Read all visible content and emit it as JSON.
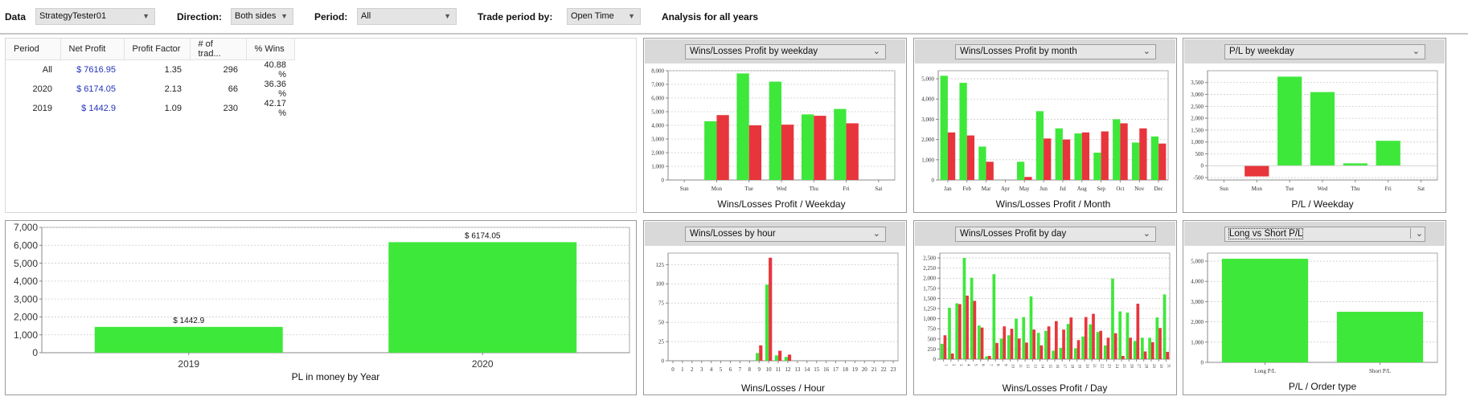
{
  "toolbar": {
    "data_label": "Data",
    "data_value": "StrategyTester01",
    "direction_label": "Direction:",
    "direction_value": "Both sides",
    "period_label": "Period:",
    "period_value": "All",
    "trade_period_label": "Trade period by:",
    "trade_period_value": "Open Time",
    "analysis_text": "Analysis for all years",
    "dropdown_arrow": "▼"
  },
  "table": {
    "headers": [
      "Period",
      "Net Profit",
      "Profit Factor",
      "# of trad...",
      "% Wins"
    ],
    "rows": [
      [
        "All",
        "$ 7616.95",
        "1.35",
        "296",
        "40.88 %"
      ],
      [
        "2020",
        "$ 6174.05",
        "2.13",
        "66",
        "36.36 %"
      ],
      [
        "2019",
        "$ 1442.9",
        "1.09",
        "230",
        "42.17 %"
      ]
    ]
  },
  "colors": {
    "win": "#3ee83a",
    "loss": "#e8353c",
    "grid": "#cccccc",
    "axis": "#888888"
  },
  "chart_data": [
    {
      "id": "year",
      "type": "bar",
      "title": "PL in money by Year",
      "categories": [
        "2019",
        "2020"
      ],
      "values": [
        1442.9,
        6174.05
      ],
      "data_labels": [
        "$ 1442.9",
        "$ 6174.05"
      ],
      "ylim": [
        0,
        7000
      ],
      "yticks": [
        0,
        1000,
        2000,
        3000,
        4000,
        5000,
        6000,
        7000
      ],
      "ytick_labels": [
        "0",
        "1,000",
        "2,000",
        "3,000",
        "4,000",
        "5,000",
        "6,000",
        "7,000"
      ],
      "grid": true
    },
    {
      "id": "weekday_wl",
      "type": "bar",
      "selector": "Wins/Losses Profit by weekday",
      "title": "Wins/Losses Profit / Weekday",
      "categories": [
        "Sun",
        "Mon",
        "Tue",
        "Wed",
        "Thu",
        "Fri",
        "Sat"
      ],
      "series": [
        {
          "name": "Wins",
          "values": [
            0,
            4300,
            7800,
            7200,
            4800,
            5200,
            0
          ]
        },
        {
          "name": "Losses",
          "values": [
            0,
            4750,
            4000,
            4050,
            4700,
            4150,
            0
          ]
        }
      ],
      "ylim": [
        0,
        8000
      ],
      "yticks": [
        0,
        1000,
        2000,
        3000,
        4000,
        5000,
        6000,
        7000,
        8000
      ],
      "ytick_labels": [
        "0",
        "1,000",
        "2,000",
        "3,000",
        "4,000",
        "5,000",
        "6,000",
        "7,000",
        "8,000"
      ],
      "grid": true
    },
    {
      "id": "month_wl",
      "type": "bar",
      "selector": "Wins/Losses Profit by month",
      "title": "Wins/Losses Profit / Month",
      "categories": [
        "Jan",
        "Feb",
        "Mar",
        "Apr",
        "May",
        "Jun",
        "Jul",
        "Aug",
        "Sep",
        "Oct",
        "Nov",
        "Dec"
      ],
      "series": [
        {
          "name": "Wins",
          "values": [
            5150,
            4800,
            1650,
            0,
            900,
            3400,
            2550,
            2300,
            1350,
            3000,
            1850,
            2150
          ]
        },
        {
          "name": "Losses",
          "values": [
            2350,
            2200,
            900,
            0,
            150,
            2050,
            2000,
            2350,
            2400,
            2800,
            2550,
            1800
          ]
        }
      ],
      "ylim": [
        0,
        5400
      ],
      "yticks": [
        0,
        1000,
        2000,
        3000,
        4000,
        5000
      ],
      "ytick_labels": [
        "0",
        "1,000",
        "2,000",
        "3,000",
        "4,000",
        "5,000"
      ],
      "grid": true
    },
    {
      "id": "weekday_pl",
      "type": "bar",
      "selector": "P/L by weekday",
      "title": "P/L / Weekday",
      "categories": [
        "Sun",
        "Mon",
        "Tue",
        "Wed",
        "Thu",
        "Fri",
        "Sat"
      ],
      "values": [
        0,
        -450,
        3750,
        3100,
        100,
        1050,
        0
      ],
      "ylim": [
        -600,
        4000
      ],
      "yticks": [
        -500,
        0,
        500,
        1000,
        1500,
        2000,
        2500,
        3000,
        3500
      ],
      "ytick_labels": [
        "-500",
        "0",
        "500",
        "1,000",
        "1,500",
        "2,000",
        "2,500",
        "3,000",
        "3,500"
      ],
      "grid": true
    },
    {
      "id": "hour_wl",
      "type": "bar",
      "selector": "Wins/Losses by hour",
      "title": "Wins/Losses / Hour",
      "categories": [
        "0",
        "1",
        "2",
        "3",
        "4",
        "5",
        "6",
        "7",
        "8",
        "9",
        "10",
        "11",
        "12",
        "13",
        "14",
        "15",
        "16",
        "17",
        "18",
        "19",
        "20",
        "21",
        "22",
        "23"
      ],
      "series": [
        {
          "name": "Wins",
          "values": [
            0,
            0,
            0,
            0,
            0,
            0,
            0,
            0,
            0,
            10,
            99,
            7,
            5,
            0,
            0,
            0,
            0,
            0,
            0,
            0,
            0,
            0,
            0,
            0
          ]
        },
        {
          "name": "Losses",
          "values": [
            0,
            0,
            0,
            0,
            0,
            0,
            0,
            0,
            0,
            20,
            134,
            13,
            8,
            0,
            0,
            0,
            0,
            0,
            0,
            0,
            0,
            0,
            0,
            0
          ]
        }
      ],
      "ylim": [
        0,
        140
      ],
      "yticks": [
        0,
        25,
        50,
        75,
        100,
        125
      ],
      "ytick_labels": [
        "0",
        "25",
        "50",
        "75",
        "100",
        "125"
      ],
      "grid": true
    },
    {
      "id": "day_wl",
      "type": "bar",
      "selector": "Wins/Losses Profit by day",
      "title": "Wins/Losses Profit / Day",
      "categories": [
        "1",
        "2",
        "3",
        "4",
        "5",
        "6",
        "7",
        "8",
        "9",
        "10",
        "11",
        "12",
        "13",
        "14",
        "15",
        "16",
        "17",
        "18",
        "19",
        "20",
        "21",
        "22",
        "23",
        "24",
        "25",
        "26",
        "27",
        "28",
        "29",
        "30",
        "31"
      ],
      "series": [
        {
          "name": "Wins",
          "values": [
            380,
            1270,
            1380,
            2500,
            2010,
            830,
            70,
            2100,
            510,
            590,
            1000,
            1040,
            1550,
            650,
            700,
            210,
            280,
            870,
            270,
            560,
            860,
            670,
            340,
            1990,
            1180,
            1150,
            450,
            530,
            530,
            1030,
            1600
          ]
        },
        {
          "name": "Losses",
          "values": [
            590,
            140,
            1360,
            1570,
            1440,
            780,
            80,
            400,
            810,
            750,
            510,
            410,
            730,
            340,
            810,
            940,
            730,
            1030,
            470,
            1040,
            1120,
            700,
            530,
            640,
            80,
            530,
            1370,
            190,
            420,
            770,
            180
          ]
        }
      ],
      "ylim": [
        0,
        2620
      ],
      "yticks": [
        0,
        250,
        500,
        750,
        1000,
        1250,
        1500,
        1750,
        2000,
        2250,
        2500
      ],
      "ytick_labels": [
        "0",
        "250",
        "500",
        "750",
        "1,000",
        "1,250",
        "1,500",
        "1,750",
        "2,000",
        "2,250",
        "2,500"
      ],
      "grid": true
    },
    {
      "id": "order_type",
      "type": "bar",
      "selector": "Long vs Short P/L",
      "title": "P/L / Order type",
      "categories": [
        "Long P/L",
        "Short P/L"
      ],
      "values": [
        5120,
        2500
      ],
      "ylim": [
        0,
        5400
      ],
      "yticks": [
        0,
        1000,
        2000,
        3000,
        4000,
        5000
      ],
      "ytick_labels": [
        "0",
        "1,000",
        "2,000",
        "3,000",
        "4,000",
        "5,000"
      ],
      "grid": true
    }
  ]
}
